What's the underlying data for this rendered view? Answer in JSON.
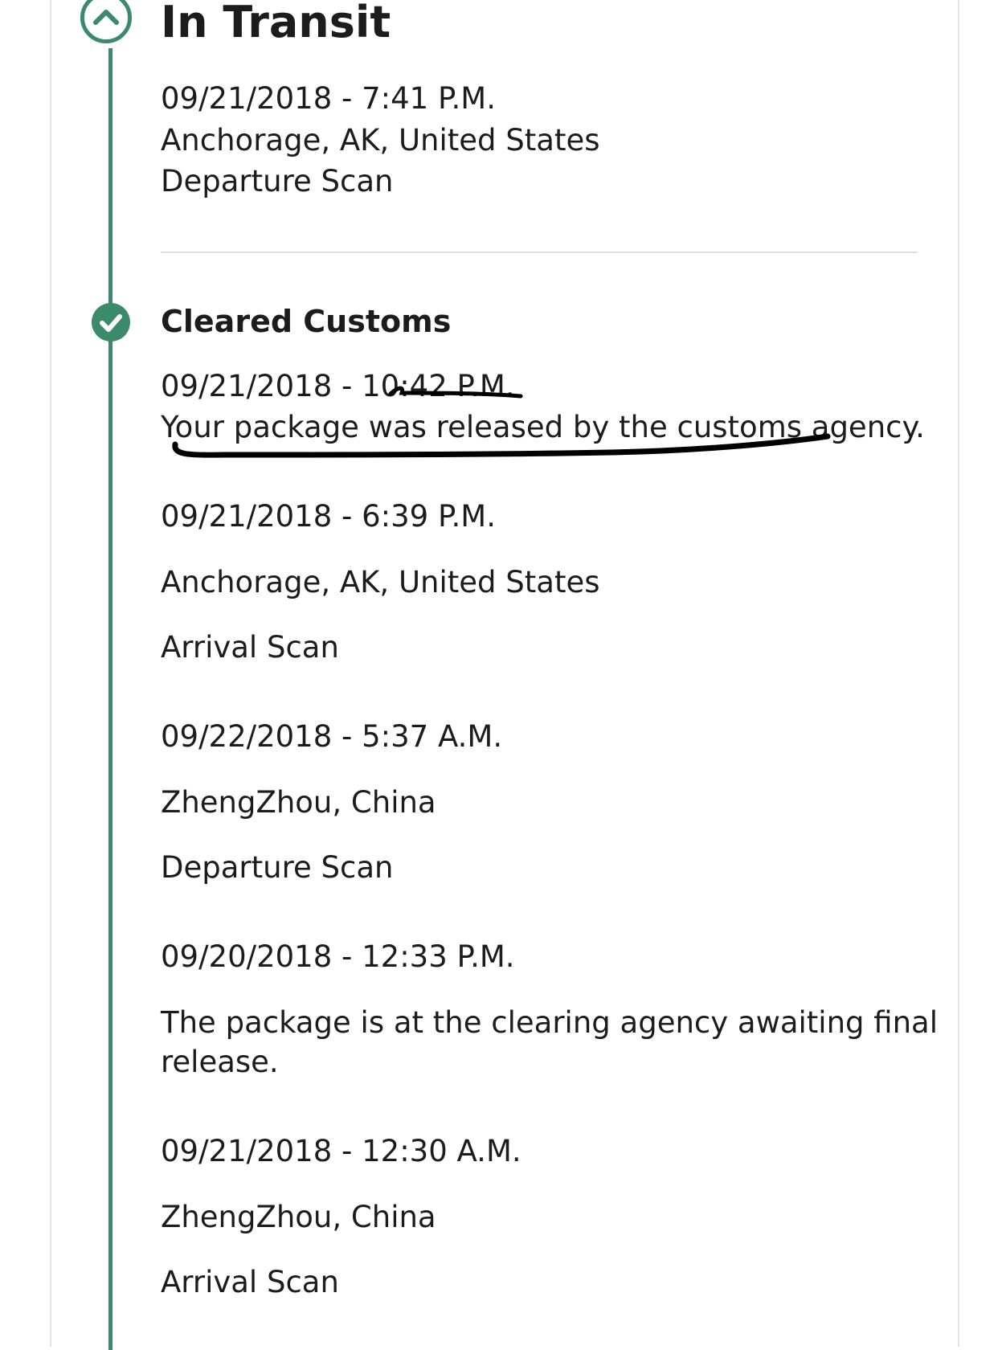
{
  "in_transit": {
    "title": "In Transit",
    "icon": "chevron-up-icon",
    "latest_event": {
      "datetime": "09/21/2018 - 7:41 P.M.",
      "location": "Anchorage, AK, United States",
      "status": "Departure Scan"
    }
  },
  "cleared_customs": {
    "title": "Cleared Customs",
    "icon": "check-icon",
    "events": [
      {
        "datetime": "09/21/2018 - 10:42 P.M.",
        "description": "Your package was released by the customs agency."
      },
      {
        "datetime": "09/21/2018 - 6:39 P.M.",
        "location": "Anchorage, AK, United States",
        "status": "Arrival Scan"
      },
      {
        "datetime": "09/22/2018 - 5:37 A.M.",
        "location": "ZhengZhou, China",
        "status": "Departure Scan"
      },
      {
        "datetime": "09/20/2018 - 12:33 P.M.",
        "description_line1": "The package is at the clearing agency awaiting final",
        "description_line2": "release."
      },
      {
        "datetime": "09/21/2018 - 12:30 A.M.",
        "location": "ZhengZhou, China",
        "status": "Arrival Scan"
      }
    ]
  },
  "colors": {
    "accent": "#3b8a6b",
    "text": "#1c1c1c",
    "divider": "#e1e1e1",
    "card_border": "#e3e3e3",
    "annotation_ink": "#000000"
  }
}
